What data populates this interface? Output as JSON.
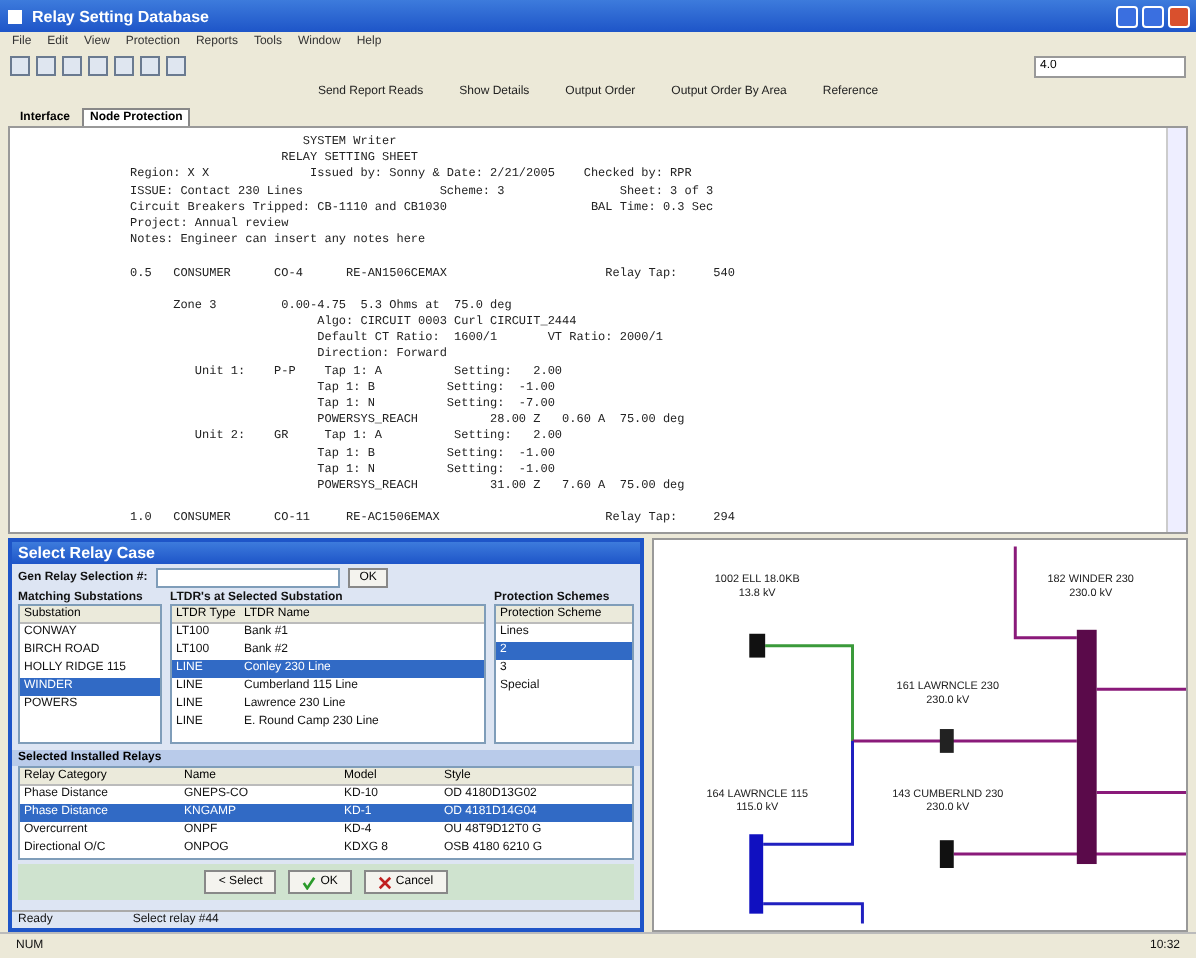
{
  "window": {
    "title": "Relay Setting Database"
  },
  "menu": [
    "File",
    "Edit",
    "View",
    "Protection",
    "Reports",
    "Tools",
    "Window",
    "Help"
  ],
  "zoom_field": {
    "value": "4.0"
  },
  "report_buttons": [
    "Send Report Reads",
    "Show Details",
    "Output Order",
    "Output Order By Area",
    "Reference"
  ],
  "tabs": [
    {
      "label": "Interface",
      "selected": false
    },
    {
      "label": "Node Protection",
      "selected": true
    }
  ],
  "report": {
    "blocks": [
      [
        "                        SYSTEM Writer",
        "                     RELAY SETTING SHEET",
        "Region: X X              Issued by: Sonny & Date: 2/21/2005    Checked by: RPR",
        "ISSUE: Contact 230 Lines                   Scheme: 3                Sheet: 3 of 3",
        "Circuit Breakers Tripped: CB-1110 and CB1030                    BAL Time: 0.3 Sec",
        "Project: Annual review",
        "Notes: Engineer can insert any notes here"
      ],
      [
        "0.5   CONSUMER      CO-4      RE-AN1506CEMAX                      Relay Tap:     540"
      ],
      [
        "      Zone 3         0.00-4.75  5.3 Ohms at  75.0 deg",
        "                          Algo: CIRCUIT 0003 Curl CIRCUIT_2444",
        "                          Default CT Ratio:  1600/1       VT Ratio: 2000/1",
        "                          Direction: Forward",
        "         Unit 1:    P-P    Tap 1: A          Setting:   2.00",
        "                          Tap 1: B          Setting:  -1.00",
        "                          Tap 1: N          Setting:  -7.00",
        "                          POWERSYS_REACH          28.00 Z   0.60 A  75.00 deg",
        "         Unit 2:    GR     Tap 1: A          Setting:   2.00",
        "                          Tap 1: B          Setting:  -1.00",
        "                          Tap 1: N          Setting:  -1.00",
        "                          POWERSYS_REACH          31.00 Z   7.60 A  75.00 deg"
      ],
      [
        "1.0   CONSUMER      CO-11     RE-AC1506EMAX                       Relay Tap:     294"
      ]
    ]
  },
  "dialog": {
    "title": "Select Relay Case",
    "relay_label": "Gen Relay Selection #:",
    "go_button": "OK",
    "substations": {
      "heading": "Matching Substations",
      "column": "Substation",
      "items": [
        {
          "label": "CONWAY",
          "selected": false
        },
        {
          "label": "BIRCH ROAD",
          "selected": false
        },
        {
          "label": "HOLLY RIDGE 115",
          "selected": false
        },
        {
          "label": "WINDER",
          "selected": true
        },
        {
          "label": "POWERS",
          "selected": false
        }
      ]
    },
    "ltdrs": {
      "heading": "LTDR's at Selected Substation",
      "columns": [
        "LTDR Type",
        "LTDR Name"
      ],
      "rows": [
        {
          "cells": [
            "LT100",
            "Bank #1"
          ],
          "selected": false
        },
        {
          "cells": [
            "LT100",
            "Bank #2"
          ],
          "selected": false
        },
        {
          "cells": [
            "LINE",
            "Conley 230 Line"
          ],
          "selected": true
        },
        {
          "cells": [
            "LINE",
            "Cumberland 115 Line"
          ],
          "selected": false
        },
        {
          "cells": [
            "LINE",
            "Lawrence 230 Line"
          ],
          "selected": false
        },
        {
          "cells": [
            "LINE",
            "E. Round Camp 230 Line"
          ],
          "selected": false
        }
      ]
    },
    "schemes": {
      "heading": "Protection Schemes",
      "column": "Protection Scheme",
      "items": [
        {
          "label": "Lines",
          "selected": false
        },
        {
          "label": "2",
          "selected": true
        },
        {
          "label": "3",
          "selected": false
        },
        {
          "label": "Special",
          "selected": false
        }
      ]
    },
    "installed": {
      "heading": "Selected Installed Relays",
      "columns": [
        "Relay Category",
        "Name",
        "Model",
        "Style"
      ],
      "rows": [
        {
          "cells": [
            "Phase Distance",
            "GNEPS-CO",
            "KD-10",
            "OD 4180D13G02"
          ],
          "selected": false
        },
        {
          "cells": [
            "Phase Distance",
            "KNGAMP",
            "KD-1",
            "OD 4181D14G04"
          ],
          "selected": true
        },
        {
          "cells": [
            "Overcurrent",
            "ONPF",
            "KD-4",
            "OU 48T9D12T0 G"
          ],
          "selected": false
        },
        {
          "cells": [
            "Directional O/C",
            "ONPOG",
            "KDXG 8",
            "OSB 4180 6210 G"
          ],
          "selected": false
        }
      ]
    },
    "buttons": [
      {
        "label": "< Select",
        "kind": "plain"
      },
      {
        "label": "OK",
        "kind": "ok"
      },
      {
        "label": "Cancel",
        "kind": "cancel"
      }
    ],
    "status": [
      "Ready",
      "Select relay #44"
    ]
  },
  "diagram": {
    "buses": [
      {
        "name": "1002 ELL 18.0KB",
        "voltage": "13.8 kV"
      },
      {
        "name": "182 WINDER 230",
        "voltage": "230.0 kV"
      },
      {
        "name": "161 LAWRNCLE 230",
        "voltage": "230.0 kV"
      },
      {
        "name": "164 LAWRNCLE 115",
        "voltage": "115.0 kV"
      },
      {
        "name": "143 CUMBERLND 230",
        "voltage": "230.0 kV"
      }
    ]
  },
  "status_bar": [
    "NUM",
    "10:32"
  ]
}
